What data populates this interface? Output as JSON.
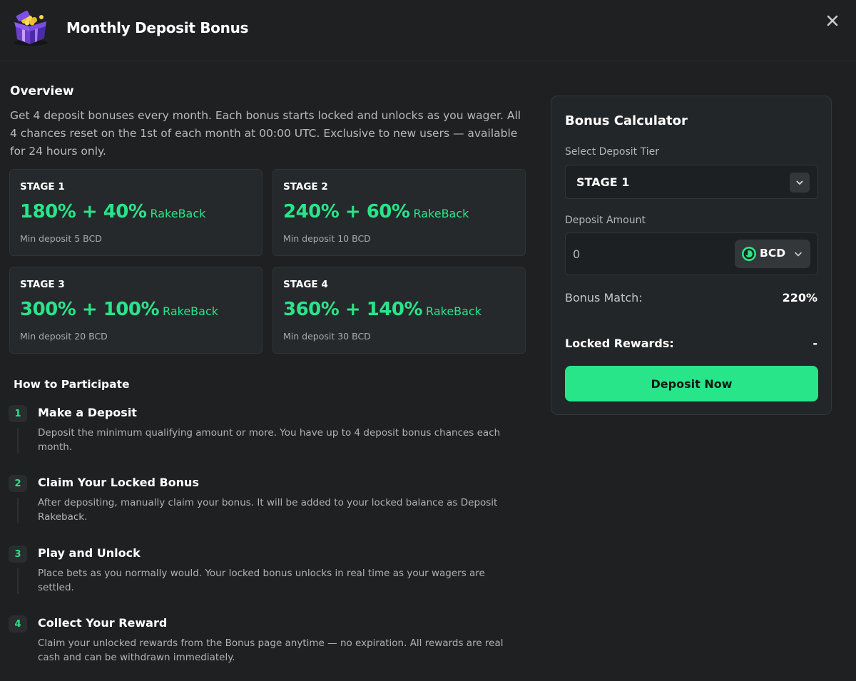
{
  "header": {
    "title": "Monthly Deposit Bonus",
    "close_icon": "close-icon"
  },
  "overview": {
    "title": "Overview",
    "text": "Get 4 deposit bonuses every month. Each bonus starts locked and unlocks as you wager. All 4 chances reset on the 1st of each month at 00:00 UTC. Exclusive to new users — available for 24 hours only."
  },
  "stages": [
    {
      "label": "STAGE 1",
      "value": "180% + 40%",
      "suffix": "RakeBack",
      "min": "Min deposit 5 BCD"
    },
    {
      "label": "STAGE 2",
      "value": "240% + 60%",
      "suffix": "RakeBack",
      "min": "Min deposit 10 BCD"
    },
    {
      "label": "STAGE 3",
      "value": "300% + 100%",
      "suffix": "RakeBack",
      "min": "Min deposit 20 BCD"
    },
    {
      "label": "STAGE 4",
      "value": "360% + 140%",
      "suffix": "RakeBack",
      "min": "Min deposit 30 BCD"
    }
  ],
  "how": {
    "title": "How to Participate",
    "steps": [
      {
        "num": "1",
        "title": "Make a Deposit",
        "desc": "Deposit the minimum qualifying amount or more. You have up to 4 deposit bonus chances each month."
      },
      {
        "num": "2",
        "title": "Claim Your Locked Bonus",
        "desc": "After depositing, manually claim your bonus. It will be added to your locked balance as Deposit Rakeback."
      },
      {
        "num": "3",
        "title": "Play and Unlock",
        "desc": "Place bets as you normally would. Your locked bonus unlocks in real time as your wagers are settled."
      },
      {
        "num": "4",
        "title": "Collect Your Reward",
        "desc": "Claim your unlocked rewards from the Bonus page anytime — no expiration. All rewards are real cash and can be withdrawn immediately."
      }
    ]
  },
  "calculator": {
    "title": "Bonus Calculator",
    "tier_label": "Select Deposit Tier",
    "tier_value": "STAGE 1",
    "amount_label": "Deposit Amount",
    "amount_placeholder": "0",
    "currency": "BCD",
    "bonus_match_label": "Bonus Match:",
    "bonus_match_value": "220%",
    "locked_rewards_label": "Locked Rewards:",
    "locked_rewards_value": "-",
    "deposit_button": "Deposit Now"
  },
  "colors": {
    "accent": "#29e58a",
    "background": "#1e2021",
    "card": "#26292b"
  }
}
